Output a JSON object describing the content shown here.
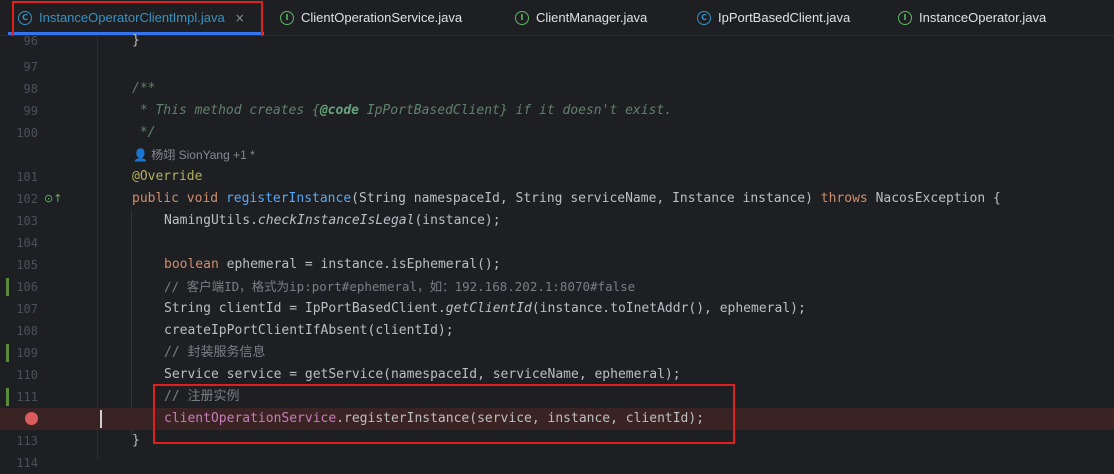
{
  "tabs": [
    {
      "label": "InstanceOperatorClientImpl.java",
      "icon": "class-icon",
      "active": true
    },
    {
      "label": "ClientOperationService.java",
      "icon": "interface-icon"
    },
    {
      "label": "ClientManager.java",
      "icon": "interface-icon"
    },
    {
      "label": "IpPortBasedClient.java",
      "icon": "class-icon"
    },
    {
      "label": "InstanceOperator.java",
      "icon": "interface-icon"
    }
  ],
  "tab_close_glyph": "×",
  "class_icon_glyph": "C",
  "interface_icon_glyph": "I",
  "editor": {
    "line_numbers": [
      "96",
      "97",
      "98",
      "99",
      "100",
      "101",
      "102",
      "103",
      "104",
      "105",
      "106",
      "107",
      "108",
      "109",
      "110",
      "111",
      "",
      "113",
      "114"
    ],
    "author_hint": "杨翊 SionYang +1 *",
    "code": {
      "l96": "}",
      "l98_doc_open": "/**",
      "l99_doc_a": " * This method creates {",
      "l99_doc_tag": "@code",
      "l99_doc_b": " IpPortBasedClient} if it doesn't exist.",
      "l100_doc_close": " */",
      "l101_annotation": "@Override",
      "l102_public": "public",
      "l102_void": " void ",
      "l102_method": "registerInstance",
      "l102_params": "(String namespaceId, String serviceName, Instance instance) ",
      "l102_throws": "throws",
      "l102_rest": " NacosException {",
      "l103_a": "NamingUtils.",
      "l103_b": "checkInstanceIsLegal",
      "l103_c": "(instance);",
      "l105_kw": "boolean",
      "l105_rest": " ephemeral = instance.isEphemeral();",
      "l106_comment": "// 客户端ID，格式为ip:port#ephemeral，如：192.168.202.1:8070#false",
      "l107_a": "String clientId = IpPortBasedClient.",
      "l107_b": "getClientId",
      "l107_c": "(instance.toInetAddr(), ephemeral);",
      "l108": "createIpPortClientIfAbsent(clientId);",
      "l109_comment": "// 封装服务信息",
      "l110": "Service service = getService(namespaceId, serviceName, ephemeral);",
      "l111_comment": "// 注册实例",
      "l112_field": "clientOperationService",
      "l112_rest": ".registerInstance(service, instance, clientId);",
      "l113": "}"
    }
  },
  "colors": {
    "background": "#1e1f22",
    "keyword": "#cf8e6d",
    "method": "#56a8f5",
    "field": "#c77dbb",
    "comment": "#7a7e85",
    "doc_comment": "#5f826b",
    "annotation": "#b3ae60",
    "highlight_box": "#e0201d",
    "breakpoint": "#db5c5c"
  }
}
